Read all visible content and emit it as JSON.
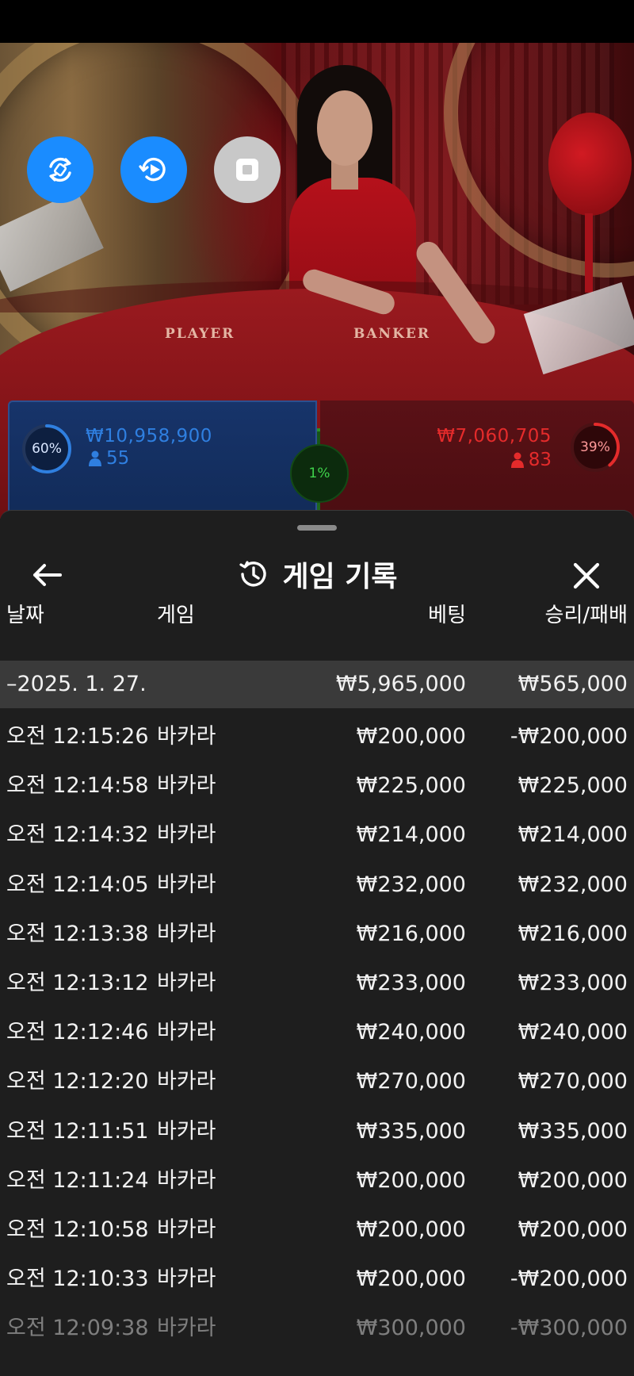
{
  "video": {
    "felt_player_label": "PLAYER",
    "felt_banker_label": "BANKER",
    "controls": [
      {
        "icon": "rotate-sync-icon",
        "color": "#1a8cff"
      },
      {
        "icon": "replay-icon",
        "color": "#1a8cff"
      },
      {
        "icon": "stop-icon",
        "color": "#c8c8c8"
      }
    ]
  },
  "bets": {
    "player": {
      "percent": "60%",
      "amount": "₩10,958,900",
      "count": "55",
      "color": "#2f7fe0"
    },
    "banker": {
      "percent": "39%",
      "amount": "₩7,060,705",
      "count": "83",
      "color": "#e42b2b"
    },
    "tie": {
      "percent": "1%",
      "color": "#3fd24b"
    }
  },
  "history": {
    "title": "게임 기록",
    "icons": {
      "back": "back-arrow-icon",
      "history": "history-icon",
      "close": "close-icon"
    },
    "columns": {
      "date": "날짜",
      "game": "게임",
      "bet": "베팅",
      "result": "승리/패배"
    },
    "group": {
      "date": "–2025. 1. 27.",
      "bet": "₩5,965,000",
      "result": "₩565,000"
    },
    "rows": [
      {
        "time": "오전 12:15:26",
        "game": "바카라",
        "bet": "₩200,000",
        "result": "-₩200,000"
      },
      {
        "time": "오전 12:14:58",
        "game": "바카라",
        "bet": "₩225,000",
        "result": "₩225,000"
      },
      {
        "time": "오전 12:14:32",
        "game": "바카라",
        "bet": "₩214,000",
        "result": "₩214,000"
      },
      {
        "time": "오전 12:14:05",
        "game": "바카라",
        "bet": "₩232,000",
        "result": "₩232,000"
      },
      {
        "time": "오전 12:13:38",
        "game": "바카라",
        "bet": "₩216,000",
        "result": "₩216,000"
      },
      {
        "time": "오전 12:13:12",
        "game": "바카라",
        "bet": "₩233,000",
        "result": "₩233,000"
      },
      {
        "time": "오전 12:12:46",
        "game": "바카라",
        "bet": "₩240,000",
        "result": "₩240,000"
      },
      {
        "time": "오전 12:12:20",
        "game": "바카라",
        "bet": "₩270,000",
        "result": "₩270,000"
      },
      {
        "time": "오전 12:11:51",
        "game": "바카라",
        "bet": "₩335,000",
        "result": "₩335,000"
      },
      {
        "time": "오전 12:11:24",
        "game": "바카라",
        "bet": "₩200,000",
        "result": "₩200,000"
      },
      {
        "time": "오전 12:10:58",
        "game": "바카라",
        "bet": "₩200,000",
        "result": "₩200,000"
      },
      {
        "time": "오전 12:10:33",
        "game": "바카라",
        "bet": "₩200,000",
        "result": "-₩200,000"
      },
      {
        "time": "오전 12:09:38",
        "game": "바카라",
        "bet": "₩300,000",
        "result": "-₩300,000"
      }
    ]
  }
}
